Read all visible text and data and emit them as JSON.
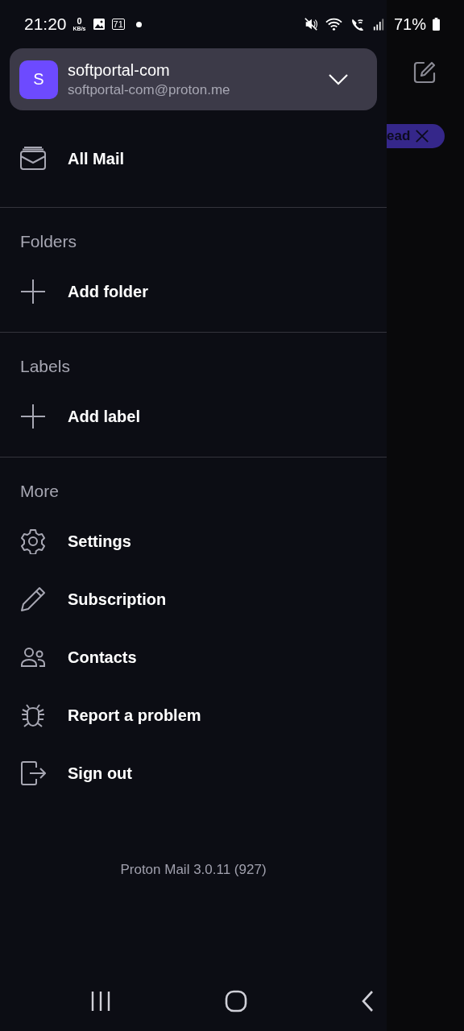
{
  "status_bar": {
    "time": "21:20",
    "net_speed": "0",
    "net_unit": "KB/s",
    "notification_badge": "71",
    "battery": "71%"
  },
  "background": {
    "filter_chip": "ead"
  },
  "drawer": {
    "account": {
      "initial": "S",
      "name": "softportal-com",
      "email": "softportal-com@proton.me",
      "expanded": false
    },
    "sections": [
      {
        "items": [
          {
            "kind": "mail",
            "label": "All Mail"
          }
        ]
      },
      {
        "title": "Folders",
        "items": [
          {
            "kind": "add",
            "label": "Add folder"
          }
        ]
      },
      {
        "title": "Labels",
        "items": [
          {
            "kind": "add",
            "label": "Add label"
          }
        ]
      },
      {
        "title": "More",
        "items": [
          {
            "kind": "settings",
            "label": "Settings"
          },
          {
            "kind": "pencil",
            "label": "Subscription"
          },
          {
            "kind": "contacts",
            "label": "Contacts"
          },
          {
            "kind": "bug",
            "label": "Report a problem"
          },
          {
            "kind": "signout",
            "label": "Sign out"
          }
        ]
      }
    ],
    "version": "Proton Mail 3.0.11 (927)"
  }
}
